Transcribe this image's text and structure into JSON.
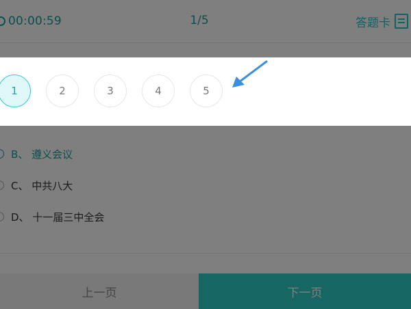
{
  "header": {
    "timer": "00:00:59",
    "progress": "1/5",
    "answer_card_label": "答题卡"
  },
  "question": {
    "options": [
      {
        "label": "B、 遵义会议",
        "selected": true
      },
      {
        "label": "C、 中共八大",
        "selected": false
      },
      {
        "label": "D、 十一届三中全会",
        "selected": false
      }
    ]
  },
  "footer": {
    "prev_label": "上一页",
    "next_label": "下一页"
  },
  "answer_card": {
    "numbers": [
      "1",
      "2",
      "3",
      "4",
      "5"
    ],
    "current": "1"
  },
  "colors": {
    "accent": "#2dcdc6",
    "accent_dark": "#159e99",
    "arrow": "#3a8fe0"
  }
}
